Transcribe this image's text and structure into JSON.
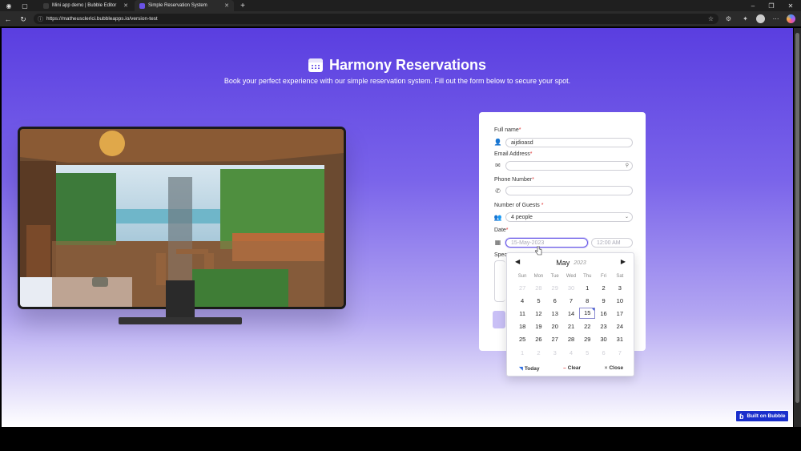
{
  "browser": {
    "tabs": [
      {
        "label": "Mini app demo | Bubble Editor",
        "active": false
      },
      {
        "label": "Simple Reservation System",
        "active": true
      }
    ],
    "url": "https://matheusclerici.bubbleapps.io/version-test"
  },
  "hero": {
    "title": "Harmony Reservations",
    "subtitle": "Book your perfect experience with our simple reservation system. Fill out the form below to secure your spot."
  },
  "form": {
    "full_name": {
      "label": "Full name",
      "required": "*",
      "value": "aijdioasd"
    },
    "email": {
      "label": "Email Address",
      "required": "*",
      "value": ""
    },
    "phone": {
      "label": "Phone Number",
      "required": "*",
      "value": ""
    },
    "guests": {
      "label": "Number of Guests ",
      "required": "*",
      "value": "4 people"
    },
    "date": {
      "label": "Date",
      "required": "*",
      "date_placeholder": "15-May-2023",
      "time_placeholder": "12:00 AM"
    },
    "special_label": "Spec"
  },
  "datepicker": {
    "month": "May",
    "year": "2023",
    "weekdays": [
      "Sun",
      "Mon",
      "Tue",
      "Wed",
      "Thu",
      "Fri",
      "Sat"
    ],
    "weeks": [
      [
        "27",
        "28",
        "29",
        "30",
        "1",
        "2",
        "3"
      ],
      [
        "4",
        "5",
        "6",
        "7",
        "8",
        "9",
        "10"
      ],
      [
        "11",
        "12",
        "13",
        "14",
        "15",
        "16",
        "17"
      ],
      [
        "18",
        "19",
        "20",
        "21",
        "22",
        "23",
        "24"
      ],
      [
        "25",
        "26",
        "27",
        "28",
        "29",
        "30",
        "31"
      ],
      [
        "1",
        "2",
        "3",
        "4",
        "5",
        "6",
        "7"
      ]
    ],
    "today": "15",
    "buttons": {
      "today": "Today",
      "clear": "Clear",
      "close": "Close"
    }
  },
  "badge": {
    "label": "Built on Bubble"
  },
  "colors": {
    "accent": "#5a3ee0",
    "badge": "#1a2fcc",
    "required": "#e03333"
  }
}
